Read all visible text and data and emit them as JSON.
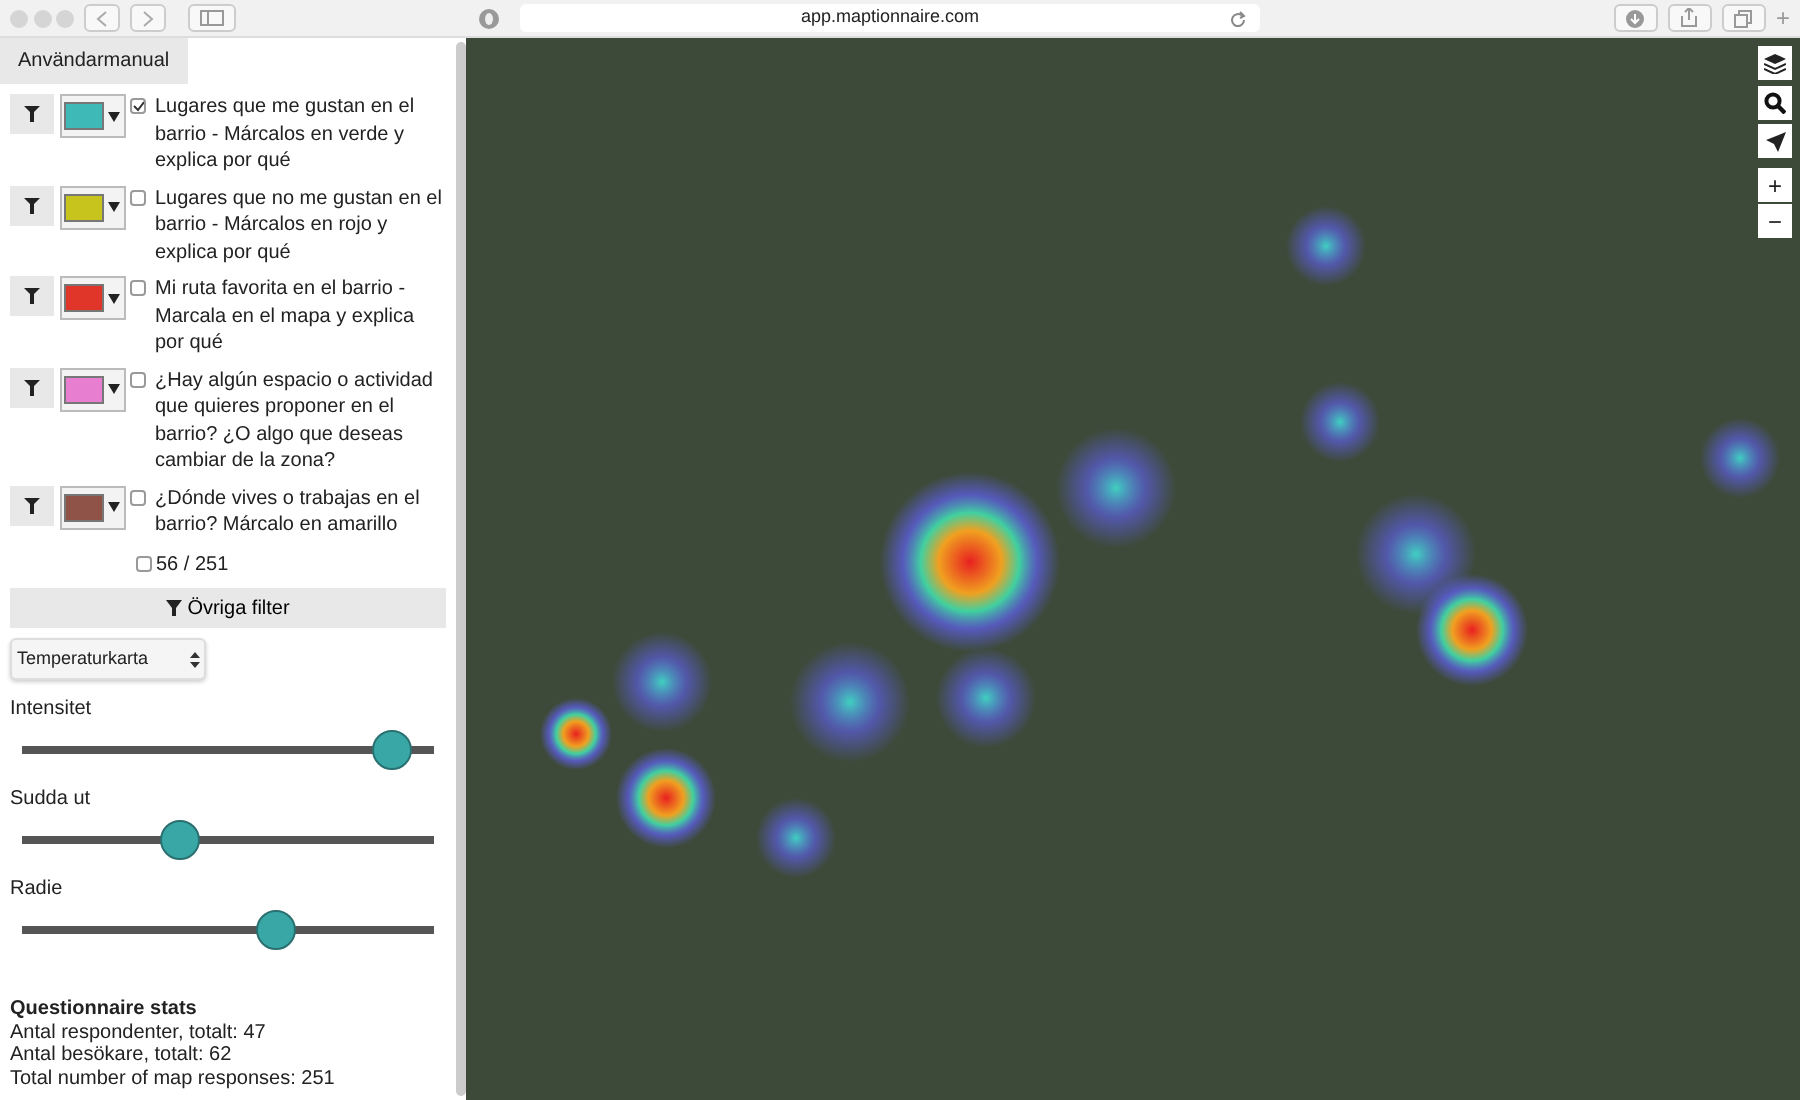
{
  "browser": {
    "url": "app.maptionnaire.com",
    "new_tab": "+"
  },
  "sidebar": {
    "manual_tab": "Användarmanual",
    "layers": [
      {
        "label": "Lugares que me gustan en el barrio - Márcalos en verde y explica por qué",
        "checked": true,
        "color": "#3fb8b8"
      },
      {
        "label": "Lugares que no me gustan en el barrio - Márcalos en rojo y explica por qué",
        "checked": false,
        "color": "#c8c41e"
      },
      {
        "label": "Mi ruta favorita en el barrio - Marcala en el mapa y explica por qué",
        "checked": false,
        "color": "#e0362a"
      },
      {
        "label": "¿Hay algún espacio o actividad que quieres proponer en el barrio? ¿O algo que deseas cambiar de la zona?",
        "checked": false,
        "color": "#e77ed0"
      },
      {
        "label": "¿Dónde vives o trabajas en el barrio? Márcalo en amarillo",
        "checked": false,
        "color": "#8f5347"
      }
    ],
    "count": {
      "label": "56 / 251",
      "checked": false
    },
    "other_filters": "Övriga filter",
    "map_type": "Temperaturkarta",
    "sliders": [
      {
        "label": "Intensitet",
        "level": 0.94
      },
      {
        "label": "Sudda ut",
        "level": 0.37
      },
      {
        "label": "Radie",
        "level": 0.63
      }
    ],
    "stats": {
      "title": "Questionnaire stats",
      "lines": [
        "Antal respondenter, totalt: 47",
        "Antal besökare, totalt: 62",
        "Total number of map responses: 251"
      ]
    }
  },
  "map": {
    "zoom_in": "+",
    "zoom_out": "−"
  }
}
